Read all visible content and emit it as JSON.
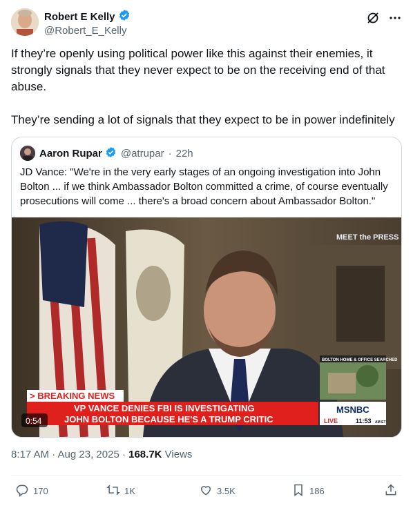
{
  "author": {
    "name": "Robert E Kelly",
    "handle": "@Robert_E_Kelly"
  },
  "tweet": {
    "text": "If they’re openly using political power like this against their enemies, it strongly signals that they never expect to be on the receiving end of that abuse.\n\nThey’re sending a lot of signals that they expect to be in power indefinitely"
  },
  "quote": {
    "name": "Aaron Rupar",
    "handle": "@atrupar",
    "separator": "·",
    "time": "22h",
    "text": "JD Vance: \"We're in the very early stages of an ongoing investigation into John Bolton ... if we think Ambassador Bolton committed a crime, of course eventually prosecutions will come ... there's a broad concern about Ambassador Bolton.\""
  },
  "video": {
    "show_logo": "MEET the PRESS",
    "inset_caption": "BOLTON HOME & OFFICE SEARCHED",
    "breaking": "> BREAKING NEWS",
    "headline_1": "VP VANCE DENIES FBI IS INVESTIGATING",
    "headline_2": "JOHN BOLTON BECAUSE HE'S A TRUMP CRITIC",
    "network": "MSNBC",
    "live": "LIVE",
    "clock": "11:53",
    "clock_suffix": "AM ET",
    "duration": "0:54"
  },
  "meta": {
    "time": "8:17 AM · Aug 23, 2025 · ",
    "views_count": "168.7K",
    "views_label": " Views"
  },
  "actions": {
    "replies": "170",
    "reposts": "1K",
    "likes": "3.5K",
    "bookmarks": "186"
  },
  "colors": {
    "verified": "#1d9bf0",
    "breaking_red": "#e0201d",
    "muted": "#536471"
  }
}
